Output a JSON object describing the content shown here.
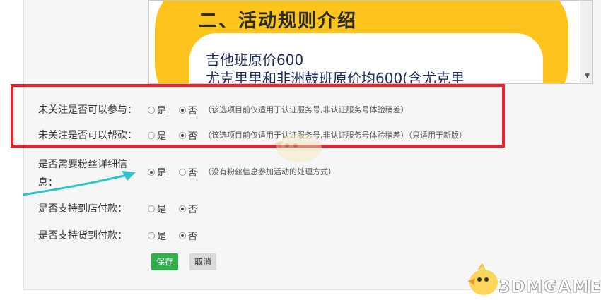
{
  "preview": {
    "title": "二、活动规则介绍",
    "line1": "吉他班原价600",
    "line2": "尤克里里和非洲鼓班原价均600(含尤克里"
  },
  "form": {
    "rows": [
      {
        "label": "未关注是否可以参与：",
        "opt_yes": "是",
        "opt_no": "否",
        "selected": "no",
        "note": "（该选项目前仅适用于认证服务号,非认证服务号体验稍差）"
      },
      {
        "label": "未关注是否可以帮砍：",
        "opt_yes": "是",
        "opt_no": "否",
        "selected": "no",
        "note": "（该选项目前仅适用于认证服务号,非认证服务号体验稍差）（只适用于新版）"
      },
      {
        "label_line1": "是否需要粉丝详细信",
        "label_line2": "息：",
        "opt_yes": "是",
        "opt_no": "否",
        "selected": "yes",
        "note": "（没有粉丝信息参加活动的处理方式）"
      },
      {
        "label": "是否支持到店付款：",
        "opt_yes": "是",
        "opt_no": "否",
        "selected": "no"
      },
      {
        "label": "是否支持货到付款：",
        "opt_yes": "是",
        "opt_no": "否",
        "selected": "no"
      }
    ]
  },
  "buttons": {
    "save": "保存",
    "cancel": "取消"
  },
  "watermark": {
    "text": "3DMGAME"
  },
  "colors": {
    "highlight": "#e8212b",
    "save": "#2fae4a",
    "arrow": "#2ec4c9",
    "poster": "#fcc41d"
  }
}
